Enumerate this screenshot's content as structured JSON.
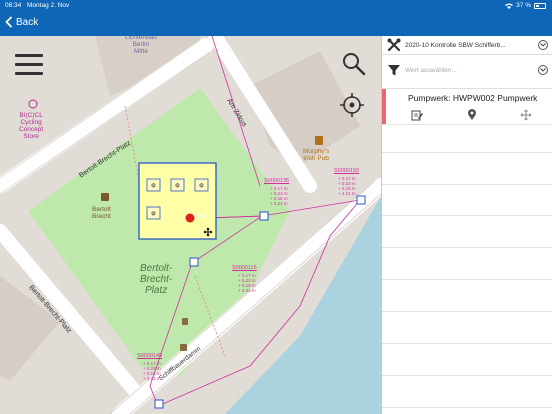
{
  "status_bar": {
    "time": "08:34",
    "date": "Montag 2. Nov",
    "battery": "37 %"
  },
  "nav": {
    "back_label": "Back"
  },
  "map": {
    "labels": {
      "poi_top": "Lichtenbau\nBerlin\nMitte",
      "cycling": "BI(C)CL\nCycling\nConcept\nStore",
      "murphys": "Murphy's\nIrish Pub",
      "bertolt_monument": "Bertolt\nBrecht",
      "park": "Bertolt-\nBrecht-\nPlatz",
      "street_bbp_top": "Bertolt-Brecht-Platz",
      "street_bbp_left": "Bertolt-Brecht-Platz",
      "street_zirkus": "Am Zirkus",
      "street_schiff": "Schiffbauerdamm",
      "pink_id_1": "S0000135",
      "pink_id_2": "S0000150",
      "pink_id_3": "S0000115",
      "pink_id_4": "S0000140",
      "pink_small": "+ 0.17 m\n+ 0.23 m\n+ 0.18 m\n+ 4.21 m"
    },
    "accent_colors": {
      "park": "#b9e9a6",
      "water": "#aad3df",
      "selection": "#2b55c8",
      "pink": "#d0309c",
      "marker": "#e02020"
    }
  },
  "panel": {
    "project_name": "2020-10 Kontrolle SBW Schifferb...",
    "filter_placeholder": "Wert auswählen...",
    "item_title": "Pumpwerk: HWPW002 Pumpwerk",
    "icons": {
      "project": "tools-icon",
      "filter": "filter-icon",
      "edit": "edit-icon",
      "location": "map-pin-icon",
      "move": "move-icon"
    }
  }
}
